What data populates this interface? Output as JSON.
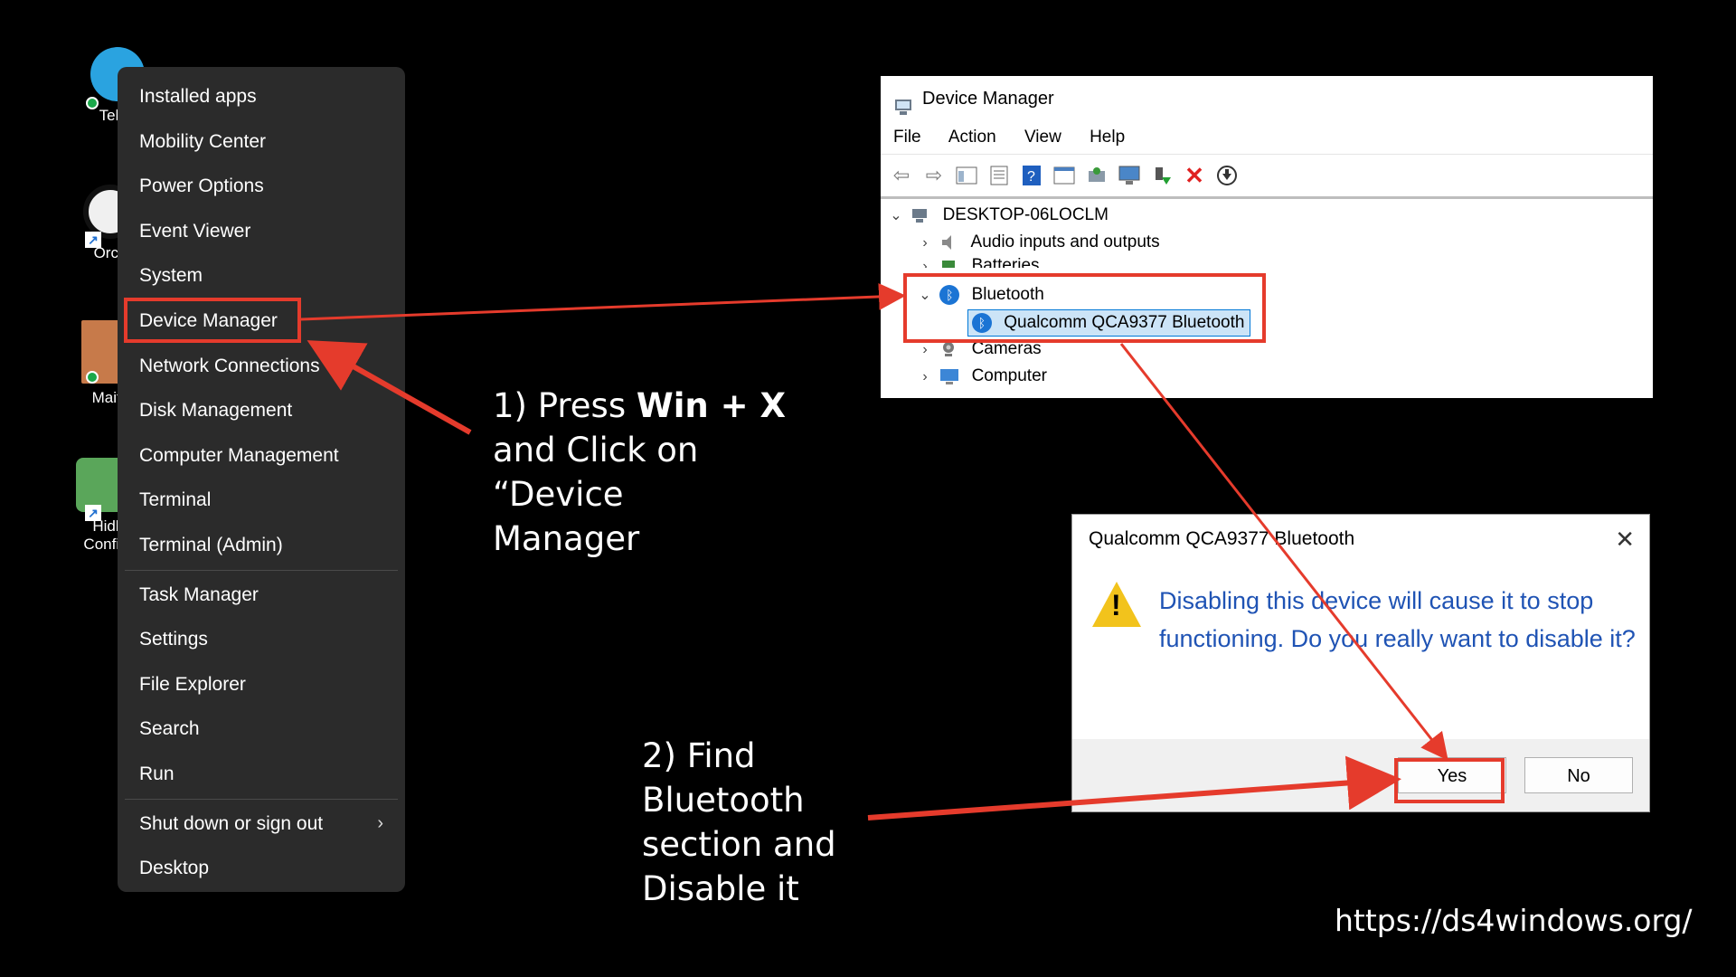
{
  "desktop": {
    "icons": [
      {
        "label": "Teleg"
      },
      {
        "label": "Orca"
      },
      {
        "label": "Maitı"
      },
      {
        "label": "Hidl Config"
      }
    ]
  },
  "winx_menu": {
    "items": [
      "Installed apps",
      "Mobility Center",
      "Power Options",
      "Event Viewer",
      "System",
      "Device Manager",
      "Network Connections",
      "Disk Management",
      "Computer Management",
      "Terminal",
      "Terminal (Admin)",
      "Task Manager",
      "Settings",
      "File Explorer",
      "Search",
      "Run",
      "Shut down or sign out",
      "Desktop"
    ]
  },
  "callouts": {
    "step1_a": "1) Press ",
    "step1_keys": "Win + X",
    "step1_b": "and Click on",
    "step1_c": "“Device",
    "step1_d": "Manager",
    "step2_a": "2) Find",
    "step2_b": "Bluetooth",
    "step2_c": "section and",
    "step2_d": "Disable it"
  },
  "device_manager": {
    "title": "Device Manager",
    "menu": [
      "File",
      "Action",
      "View",
      "Help"
    ],
    "tree": {
      "root": "DESKTOP-06LOCLM",
      "audio": "Audio inputs and outputs",
      "batteries": "Batteries",
      "bluetooth": "Bluetooth",
      "bt_device": "Qualcomm QCA9377 Bluetooth",
      "cameras": "Cameras",
      "computer": "Computer"
    }
  },
  "dialog": {
    "title": "Qualcomm QCA9377 Bluetooth",
    "message": "Disabling this device will cause it to stop functioning. Do you really want to disable it?",
    "yes": "Yes",
    "no": "No"
  },
  "site": "https://ds4windows.org/",
  "colors": {
    "highlight_red": "#e53b2c",
    "dialog_text": "#1f53b4",
    "menu_bg": "#2b2b2b"
  }
}
